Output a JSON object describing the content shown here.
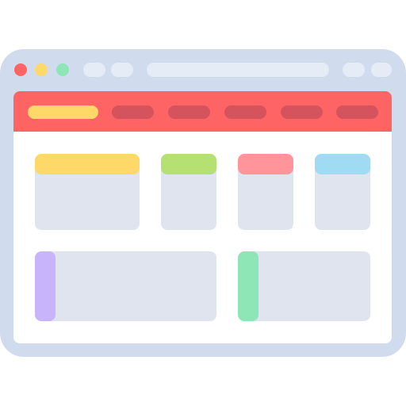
{
  "colors": {
    "window_frame": "#d1dbee",
    "window_content": "#ffffff",
    "chrome_pill": "#e6ecf6",
    "traffic_red": "#ff6464",
    "traffic_yellow": "#ffd86a",
    "traffic_green": "#8ee5b6",
    "topbar": "#ff6464",
    "menu_inactive": "#d4535d",
    "menu_active": "#ffd86a",
    "card_body": "#e0e4ee"
  },
  "cards": [
    {
      "id": "card-1",
      "accent": "#ffd86a"
    },
    {
      "id": "card-2",
      "accent": "#b4e171"
    },
    {
      "id": "card-3",
      "accent": "#ff959a"
    },
    {
      "id": "card-4",
      "accent": "#9fdcf3"
    }
  ],
  "panels": [
    {
      "id": "panel-1",
      "accent": "#c7b4fb"
    },
    {
      "id": "panel-2",
      "accent": "#8ee5b6"
    }
  ]
}
